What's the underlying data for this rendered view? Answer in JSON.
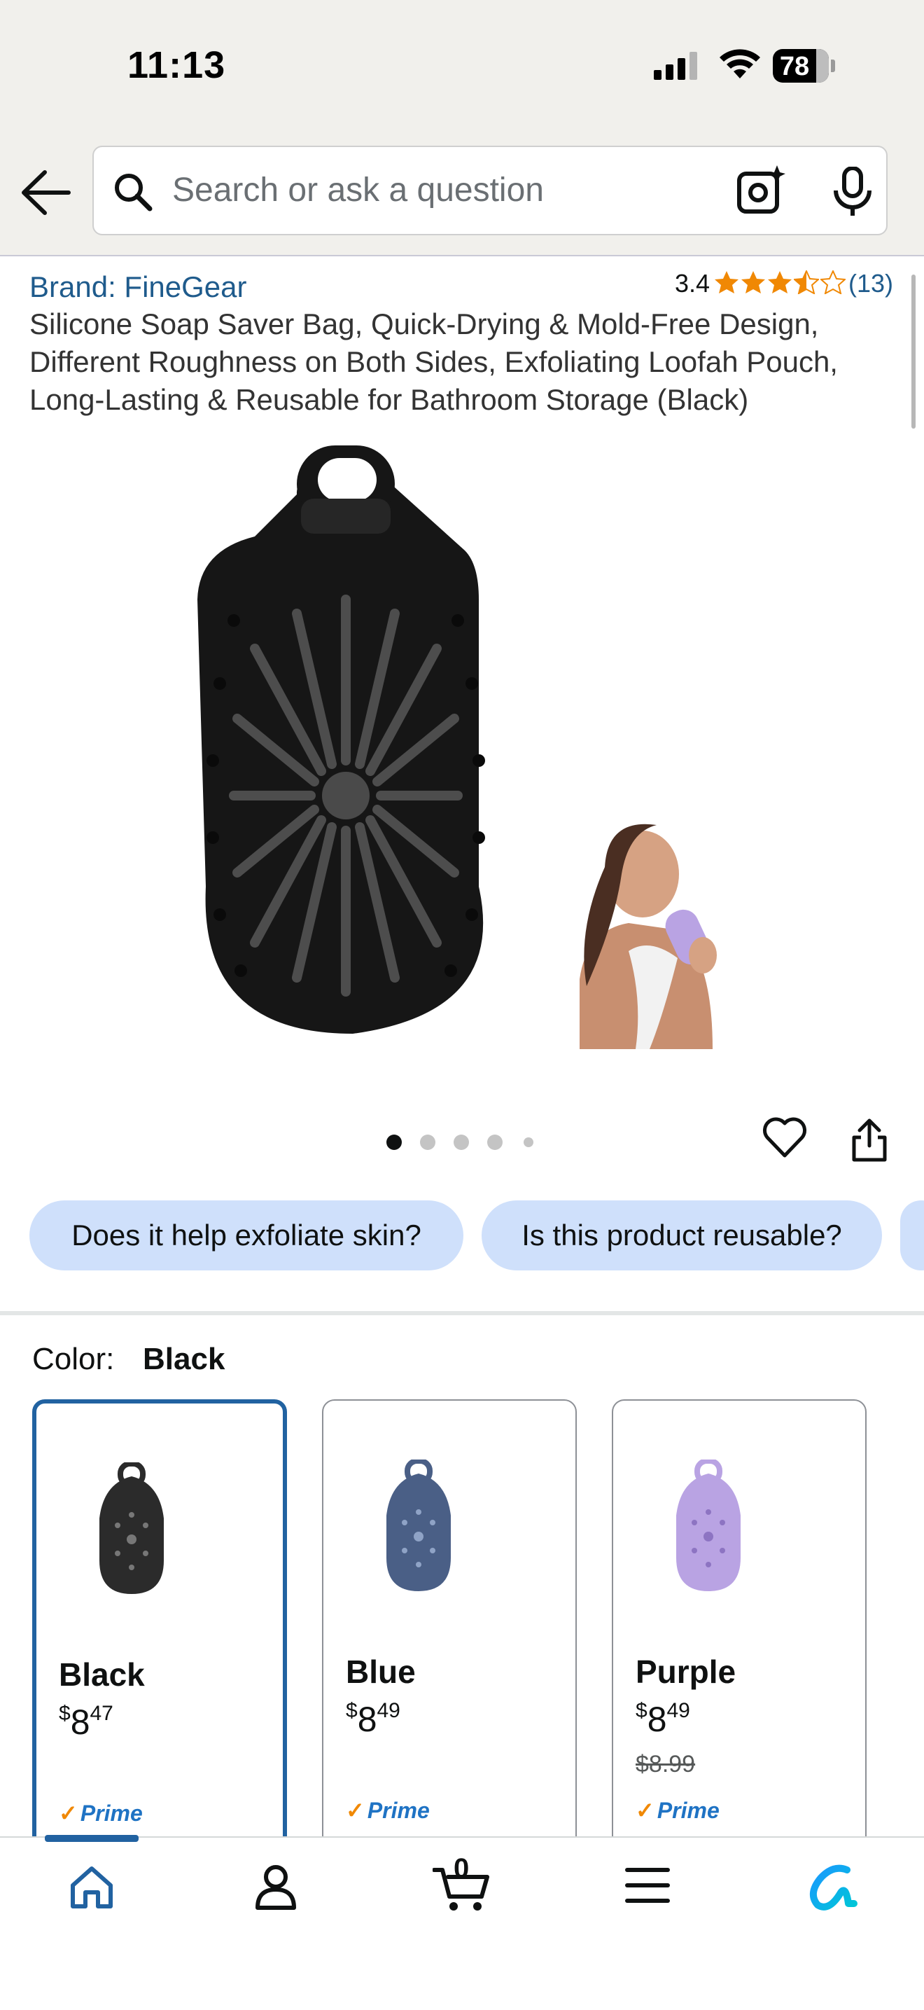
{
  "status_bar": {
    "time": "11:13",
    "battery": "78"
  },
  "search": {
    "placeholder": "Search or ask a question"
  },
  "product": {
    "brand": "Brand: FineGear",
    "rating": "3.4",
    "review_count": "(13)",
    "stars_value": 3.5,
    "title": "Silicone Soap Saver Bag, Quick-Drying & Mold-Free Design, Different Roughness on Both Sides, Exfoliating Loofah Pouch, Long-Lasting & Reusable for Bathroom Storage (Black)"
  },
  "gallery": {
    "image_count": 5,
    "active_index": 0
  },
  "questions": [
    "Does it help exfoliate skin?",
    "Is this product reusable?"
  ],
  "color": {
    "label": "Color:",
    "selected": "Black",
    "options": [
      {
        "name": "Black",
        "symbol": "$",
        "whole": "8",
        "fraction": "47",
        "old_price": "",
        "prime": "Prime",
        "tint": "#2b2b2b"
      },
      {
        "name": "Blue",
        "symbol": "$",
        "whole": "8",
        "fraction": "49",
        "old_price": "",
        "prime": "Prime",
        "tint": "#4a5f86"
      },
      {
        "name": "Purple",
        "symbol": "$",
        "whole": "8",
        "fraction": "49",
        "old_price": "$8.99",
        "prime": "Prime",
        "tint": "#b9a3e3"
      }
    ]
  },
  "cart": {
    "count": "0"
  },
  "colors": {
    "link": "#1f5b8c",
    "accent": "#2162a1",
    "star": "#f08804",
    "chip": "#cfe0fb"
  }
}
